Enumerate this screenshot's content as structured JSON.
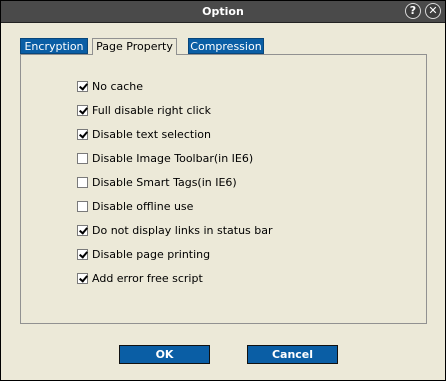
{
  "window": {
    "title": "Option",
    "help_glyph": "?",
    "close_glyph": "✕"
  },
  "tabs": [
    {
      "label": "Encryption",
      "active": false
    },
    {
      "label": "Page Property",
      "active": true
    },
    {
      "label": "Compression",
      "active": false
    }
  ],
  "options": [
    {
      "label": "No cache",
      "checked": true
    },
    {
      "label": "Full disable right click",
      "checked": true
    },
    {
      "label": "Disable text selection",
      "checked": true
    },
    {
      "label": "Disable Image Toolbar(in IE6)",
      "checked": false
    },
    {
      "label": "Disable Smart Tags(in IE6)",
      "checked": false
    },
    {
      "label": "Disable offline use",
      "checked": false
    },
    {
      "label": "Do not display links in status bar",
      "checked": true
    },
    {
      "label": "Disable page printing",
      "checked": true
    },
    {
      "label": "Add error free script",
      "checked": true
    }
  ],
  "buttons": {
    "ok_label": "OK",
    "cancel_label": "Cancel"
  },
  "colors": {
    "accent": "#0a5ea5",
    "titlebar": "#4a4a4a",
    "background": "#ece9d8"
  }
}
